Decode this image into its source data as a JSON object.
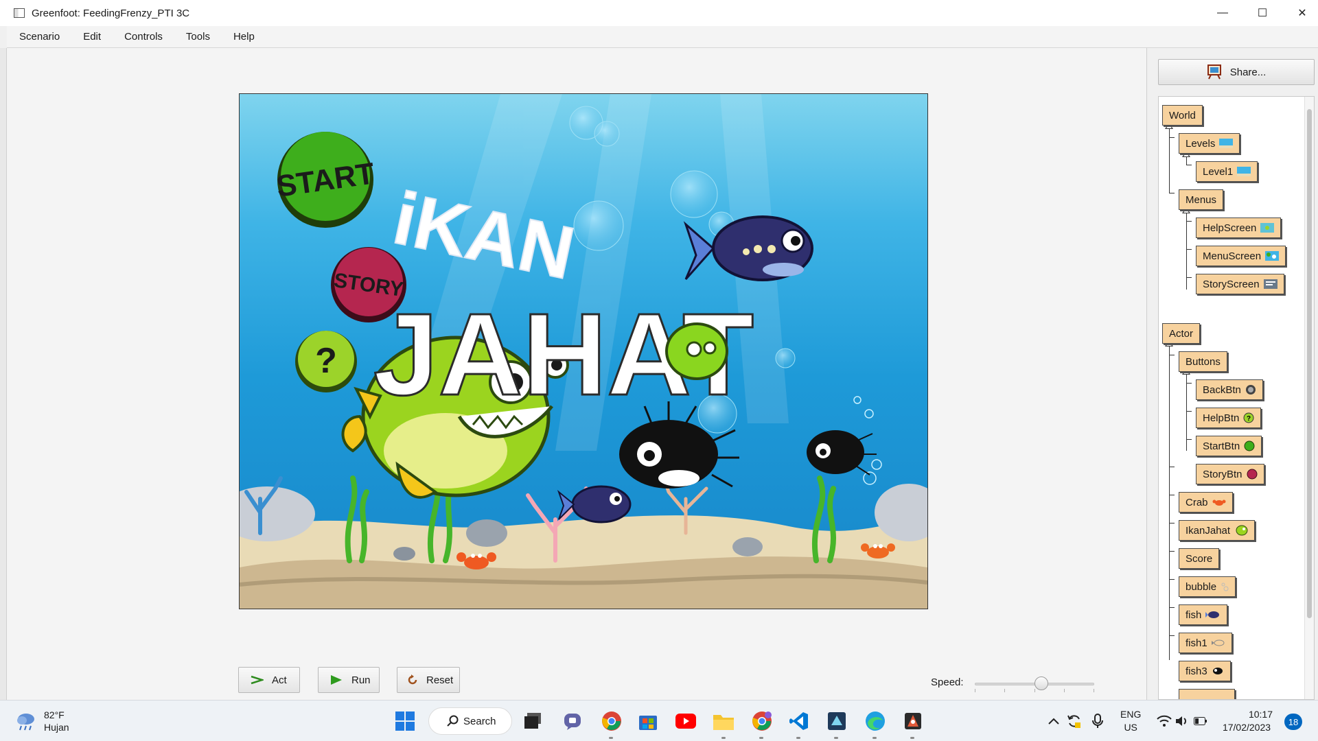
{
  "window": {
    "title": "Greenfoot: FeedingFrenzy_PTI 3C",
    "minimize_icon": "—",
    "maximize_icon": "☐",
    "close_icon": "✕"
  },
  "menu": [
    "Scenario",
    "Edit",
    "Controls",
    "Tools",
    "Help"
  ],
  "world": {
    "title_line1": "iKAN",
    "title_line2": "JAHAT",
    "start_label": "START",
    "story_label": "STORY",
    "help_label": "?"
  },
  "controls": {
    "act_label": "Act",
    "run_label": "Run",
    "reset_label": "Reset",
    "speed_label": "Speed:",
    "speed_value": 0.5
  },
  "right_panel": {
    "share_label": "Share...",
    "world_classes": [
      "World",
      "Levels",
      "Level1",
      "Menus",
      "HelpScreen",
      "MenuScreen",
      "StoryScreen"
    ],
    "actor_classes": [
      "Actor",
      "Buttons",
      "BackBtn",
      "HelpBtn",
      "StartBtn",
      "StoryBtn",
      "Crab",
      "IkanJahat",
      "Score",
      "bubble",
      "fish",
      "fish1",
      "fish3"
    ]
  },
  "taskbar": {
    "weather_temp": "82°F",
    "weather_desc": "Hujan",
    "search_label": "Search",
    "lang_line1": "ENG",
    "lang_line2": "US",
    "time": "10:17",
    "date": "17/02/2023",
    "notification_count": "18"
  },
  "colors": {
    "class_box": "#f7d29e",
    "start_button": "#3eae1c",
    "story_button": "#b5264f",
    "help_button": "#9cd32a",
    "accent": "#0067c0"
  }
}
